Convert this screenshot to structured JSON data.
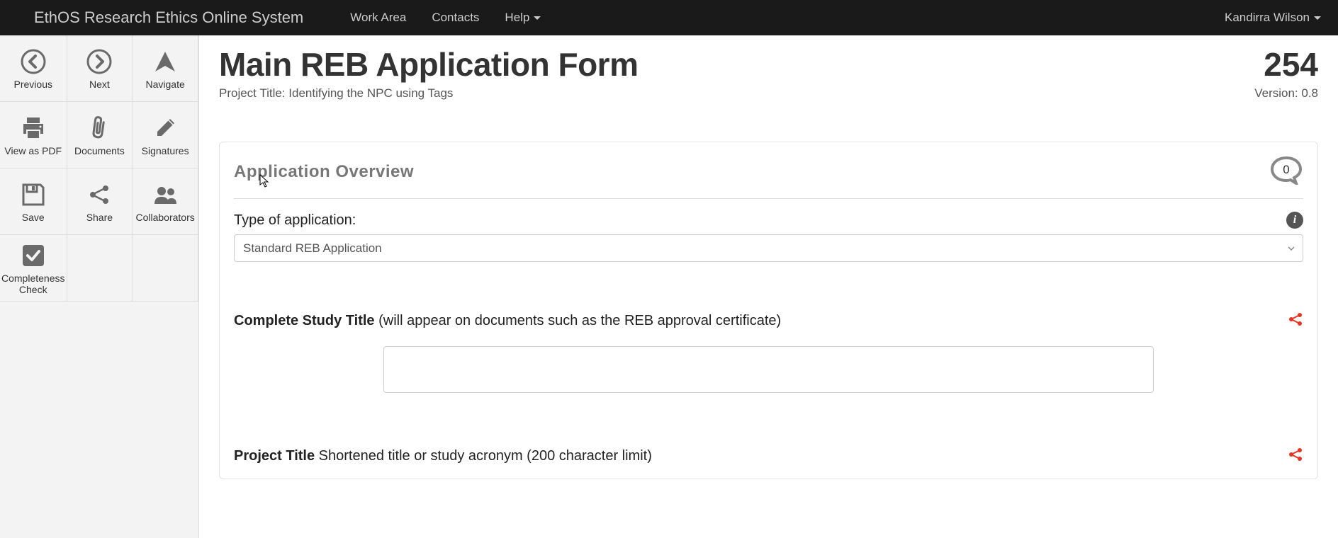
{
  "navbar": {
    "brand": "EthOS Research Ethics Online System",
    "links": {
      "work_area": "Work Area",
      "contacts": "Contacts",
      "help": "Help"
    },
    "user": "Kandirra Wilson"
  },
  "toolbar": {
    "previous": "Previous",
    "next": "Next",
    "navigate": "Navigate",
    "view_pdf": "View as PDF",
    "documents": "Documents",
    "signatures": "Signatures",
    "save": "Save",
    "share": "Share",
    "collaborators": "Collaborators",
    "completeness": "Completeness Check"
  },
  "page": {
    "title": "Main REB Application Form",
    "number": "254",
    "project_title_label": "Project Title: ",
    "project_title_value": "Identifying the NPC using Tags",
    "version": "Version: 0.8"
  },
  "form": {
    "section_title": "Application Overview",
    "comment_count": "0",
    "type_label": "Type of application:",
    "type_value": "Standard REB Application",
    "study_title_bold": "Complete Study Title",
    "study_title_hint": " (will appear on documents such as the REB approval certificate)",
    "study_title_value": "",
    "project_title_bold": "Project Title",
    "project_title_hint": " Shortened title or study acronym (200 character limit)"
  }
}
